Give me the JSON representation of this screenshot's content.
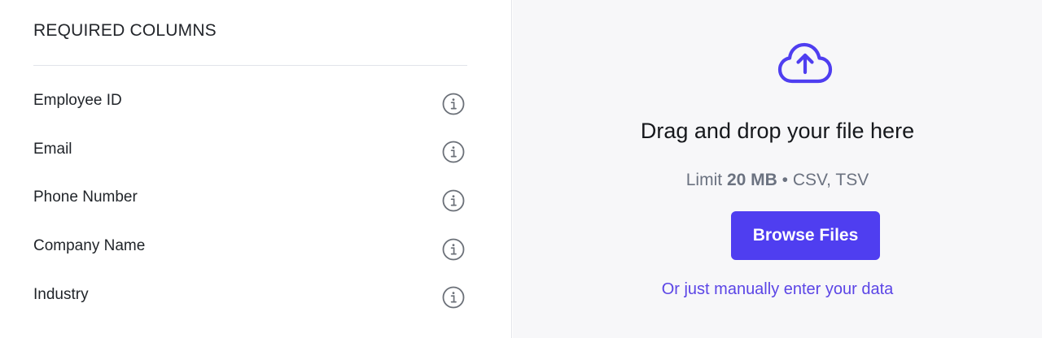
{
  "required_columns": {
    "heading": "REQUIRED COLUMNS",
    "items": [
      {
        "label": "Employee ID",
        "icon": "info-icon"
      },
      {
        "label": "Email",
        "icon": "info-icon"
      },
      {
        "label": "Phone Number",
        "icon": "info-icon"
      },
      {
        "label": "Company Name",
        "icon": "info-icon"
      },
      {
        "label": "Industry",
        "icon": "info-icon"
      }
    ]
  },
  "upload": {
    "icon": "cloud-upload-icon",
    "title": "Drag and drop your file here",
    "limit_prefix": "Limit",
    "limit_size": "20 MB",
    "limit_separator": "•",
    "limit_formats": "CSV, TSV",
    "browse_label": "Browse Files",
    "manual_link": "Or just manually enter your data"
  },
  "colors": {
    "accent": "#4f3ef0",
    "link": "#5b45e6",
    "panel_background": "#f7f7f9",
    "muted_text": "#6b7280",
    "icon_gray": "#6b7078"
  }
}
